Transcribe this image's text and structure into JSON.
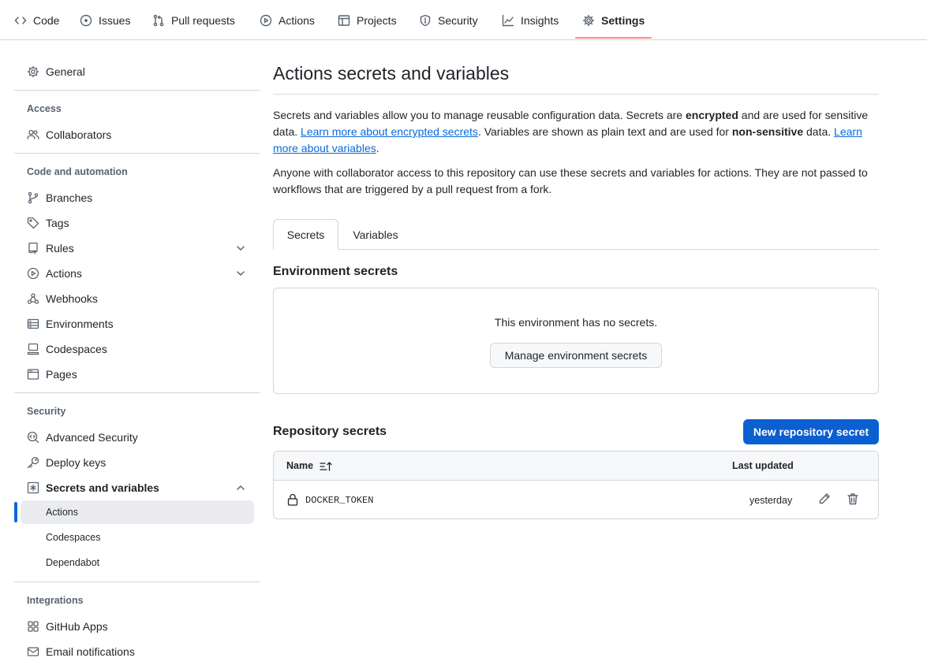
{
  "repo_nav": {
    "tabs": [
      {
        "label": "Code",
        "icon": "code-icon"
      },
      {
        "label": "Issues",
        "icon": "issue-icon"
      },
      {
        "label": "Pull requests",
        "icon": "pull-request-icon"
      },
      {
        "label": "Actions",
        "icon": "play-icon"
      },
      {
        "label": "Projects",
        "icon": "table-icon"
      },
      {
        "label": "Security",
        "icon": "shield-icon"
      },
      {
        "label": "Insights",
        "icon": "graph-icon"
      },
      {
        "label": "Settings",
        "icon": "gear-icon"
      }
    ],
    "selected": "Settings",
    "accent_color": "#fd8c73"
  },
  "sidebar": {
    "general": "General",
    "access_heading": "Access",
    "collaborators": "Collaborators",
    "code_heading": "Code and automation",
    "branches": "Branches",
    "tags": "Tags",
    "rules": "Rules",
    "actions": "Actions",
    "webhooks": "Webhooks",
    "environments": "Environments",
    "codespaces": "Codespaces",
    "pages": "Pages",
    "security_heading": "Security",
    "advanced_security": "Advanced Security",
    "deploy_keys": "Deploy keys",
    "secrets_and_variables": "Secrets and variables",
    "sub_actions": "Actions",
    "sub_codespaces": "Codespaces",
    "sub_dependabot": "Dependabot",
    "integrations_heading": "Integrations",
    "github_apps": "GitHub Apps",
    "email_notifications": "Email notifications"
  },
  "main": {
    "title": "Actions secrets and variables",
    "intro": {
      "t1": "Secrets and variables allow you to manage reusable configuration data. Secrets are ",
      "b1": "encrypted",
      "t2": " and are used for sensitive data. ",
      "link1": "Learn more about encrypted secrets",
      "t3": ". Variables are shown as plain text and are used for ",
      "b2": "non-sensitive",
      "t4": " data. ",
      "link2": "Learn more about variables",
      "t5": "."
    },
    "access_note": "Anyone with collaborator access to this repository can use these secrets and variables for actions. They are not passed to workflows that are triggered by a pull request from a fork.",
    "tabs": {
      "secrets": "Secrets",
      "variables": "Variables"
    },
    "env_secrets": {
      "title": "Environment secrets",
      "empty_text": "This environment has no secrets.",
      "manage_button": "Manage environment secrets"
    },
    "repo_secrets": {
      "title": "Repository secrets",
      "new_button": "New repository secret",
      "columns": {
        "name": "Name",
        "last_updated": "Last updated"
      },
      "rows": [
        {
          "name": "DOCKER_TOKEN",
          "updated": "yesterday"
        }
      ]
    }
  },
  "colors": {
    "primary_button": "#0b5fd0",
    "link": "#0969da",
    "active_indicator": "#0969da"
  }
}
